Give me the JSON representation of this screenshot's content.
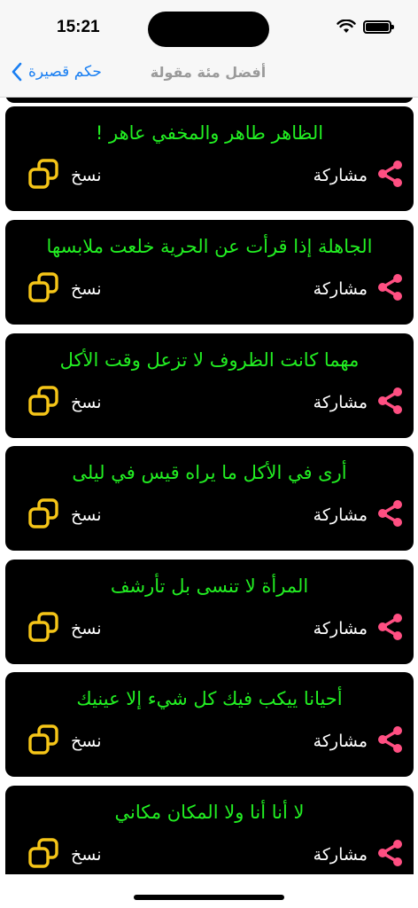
{
  "status_bar": {
    "time": "15:21"
  },
  "nav": {
    "back_label": "حكم قصيرة",
    "title": "أفضل مئة مقولة"
  },
  "colors": {
    "quote_text": "#22ee22",
    "share_icon": "#ff4f82",
    "copy_icon": "#f5c518",
    "link": "#1a7ff2",
    "card_bg": "#000000"
  },
  "icons": {
    "share": "share-icon",
    "copy": "copy-icon",
    "back": "chevron-left-icon"
  },
  "cards": [
    {
      "quote": "الظاهر طاهر والمخفي عاهر !",
      "share_label": "مشاركة",
      "copy_label": "نسخ"
    },
    {
      "quote": "الجاهلة إذا قرأت عن الحرية خلعت ملابسها",
      "share_label": "مشاركة",
      "copy_label": "نسخ"
    },
    {
      "quote": "مهما كانت الظروف لا تزعل وقت الأكل",
      "share_label": "مشاركة",
      "copy_label": "نسخ"
    },
    {
      "quote": "أرى في الأكل ما يراه قيس في ليلى",
      "share_label": "مشاركة",
      "copy_label": "نسخ"
    },
    {
      "quote": "المرأة لا تنسى بل تأرشف",
      "share_label": "مشاركة",
      "copy_label": "نسخ"
    },
    {
      "quote": "أحيانا ييكب فيك كل شيء إلا عينيك",
      "share_label": "مشاركة",
      "copy_label": "نسخ"
    },
    {
      "quote": "لا أنا أنا ولا المكان مكاني",
      "share_label": "مشاركة",
      "copy_label": "نسخ"
    }
  ]
}
